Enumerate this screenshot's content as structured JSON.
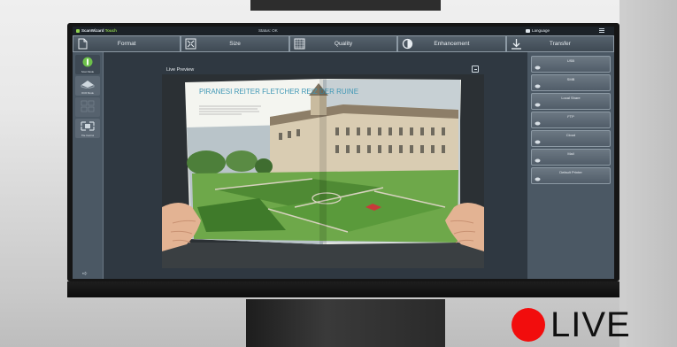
{
  "app": {
    "brand_name": "ScanWizard",
    "brand_suffix": "Touch",
    "status": "Status: OK",
    "language": "Language"
  },
  "tabs": [
    {
      "label": "Format",
      "icon": "format-icon"
    },
    {
      "label": "Size",
      "icon": "size-icon"
    },
    {
      "label": "Quality",
      "icon": "quality-icon"
    },
    {
      "label": "Enhancement",
      "icon": "enhancement-icon"
    },
    {
      "label": "Transfer",
      "icon": "transfer-icon"
    }
  ],
  "sidebar": {
    "items": [
      {
        "label": "Scan Mode",
        "icon": "scan-mode-icon"
      },
      {
        "label": "OCR Mode",
        "icon": "ocr-mode-icon"
      },
      {
        "label": "",
        "icon": "empty-slot-icon"
      },
      {
        "label": "Tile Control",
        "icon": "tile-control-icon"
      }
    ]
  },
  "preview": {
    "title": "Live Preview",
    "book_heading": "PIRANESI REITER FLETCHER REIZ DER RUINE"
  },
  "transfer": [
    {
      "label": "USB"
    },
    {
      "label": "SMB"
    },
    {
      "label": "Local Share"
    },
    {
      "label": "FTP"
    },
    {
      "label": "Cloud"
    },
    {
      "label": "Mail"
    },
    {
      "label": "Default Printer"
    }
  ],
  "overlay": {
    "live_label": "LIVE"
  },
  "colors": {
    "accent_green": "#8fd14f",
    "live_red": "#f20d0d",
    "panel": "#4b5864"
  }
}
